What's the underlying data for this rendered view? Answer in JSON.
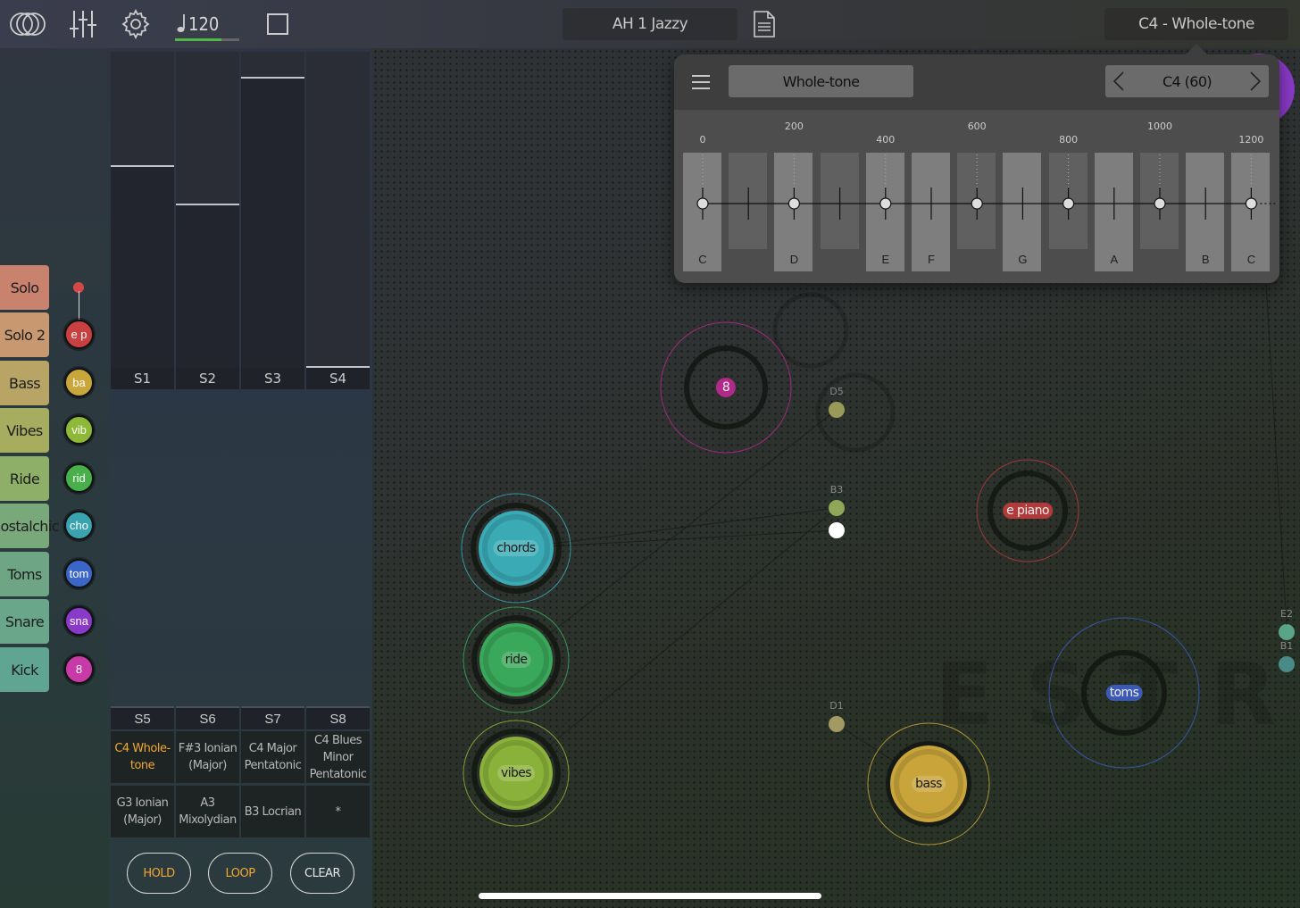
{
  "topbar": {
    "tempo": "120",
    "tempo_progress": 0.72,
    "preset": "AH 1 Jazzy",
    "scale_button": "C4 - Whole-tone"
  },
  "tracks": [
    {
      "label": "Solo",
      "dot": "",
      "color": "#c8826e",
      "dot_color": "#d64848"
    },
    {
      "label": "Solo 2",
      "dot": "e p",
      "color": "#c89970",
      "dot_color": "#c84040"
    },
    {
      "label": "Bass",
      "dot": "ba",
      "color": "#b8a566",
      "dot_color": "#c9a63a"
    },
    {
      "label": "Vibes",
      "dot": "vib",
      "color": "#a6ad5e",
      "dot_color": "#8db838"
    },
    {
      "label": "Ride",
      "dot": "rid",
      "color": "#8eaf68",
      "dot_color": "#48b04a"
    },
    {
      "label": "Nostalchic",
      "dot": "cho",
      "color": "#79a87a",
      "dot_color": "#39a3b0"
    },
    {
      "label": "Toms",
      "dot": "tom",
      "color": "#6ea685",
      "dot_color": "#3a66c8"
    },
    {
      "label": "Snare",
      "dot": "sna",
      "color": "#69a68a",
      "dot_color": "#8a3ac8"
    },
    {
      "label": "Kick",
      "dot": "8",
      "color": "#5fa592",
      "dot_color": "#c83aa8"
    }
  ],
  "sliders": [
    {
      "label": "S1",
      "level": 0.64
    },
    {
      "label": "S2",
      "level": 0.52
    },
    {
      "label": "S3",
      "level": 0.92
    },
    {
      "label": "S4",
      "level": 0.0
    }
  ],
  "scenes": {
    "headers": [
      "S5",
      "S6",
      "S7",
      "S8"
    ],
    "cells": [
      "C4 Whole-tone",
      "F#3 Ionian (Major)",
      "C4 Major Pentatonic",
      "C4 Blues Minor Pentatonic",
      "G3 Ionian (Major)",
      "A3 Mixolydian",
      "B3 Locrian",
      "*"
    ],
    "active_index": 0
  },
  "buttons": {
    "hold": "HOLD",
    "loop": "LOOP",
    "clear": "CLEAR"
  },
  "popup": {
    "scale_name": "Whole-tone",
    "root": "C4 (60)",
    "cents": [
      "0",
      "200",
      "400",
      "600",
      "800",
      "1000",
      "1200"
    ],
    "keys": [
      "C",
      "",
      "D",
      "",
      "E",
      "F",
      "",
      "G",
      "",
      "A",
      "",
      "B",
      "C"
    ]
  },
  "canvas": {
    "watermark": "ESTRUMENT",
    "nodes": [
      {
        "label": "8",
        "color": "#b02a8a"
      },
      {
        "label": "e piano",
        "color": "#b23a3a"
      },
      {
        "label": "chords",
        "color": "#3aaab5"
      },
      {
        "label": "ride",
        "color": "#3aa85a"
      },
      {
        "label": "vibes",
        "color": "#8ab23a"
      },
      {
        "label": "bass",
        "color": "#c8a43a"
      },
      {
        "label": "toms",
        "color": "#3a5ab5"
      }
    ],
    "pins": [
      "D5",
      "B3",
      "D1",
      "E2",
      "B1"
    ]
  }
}
